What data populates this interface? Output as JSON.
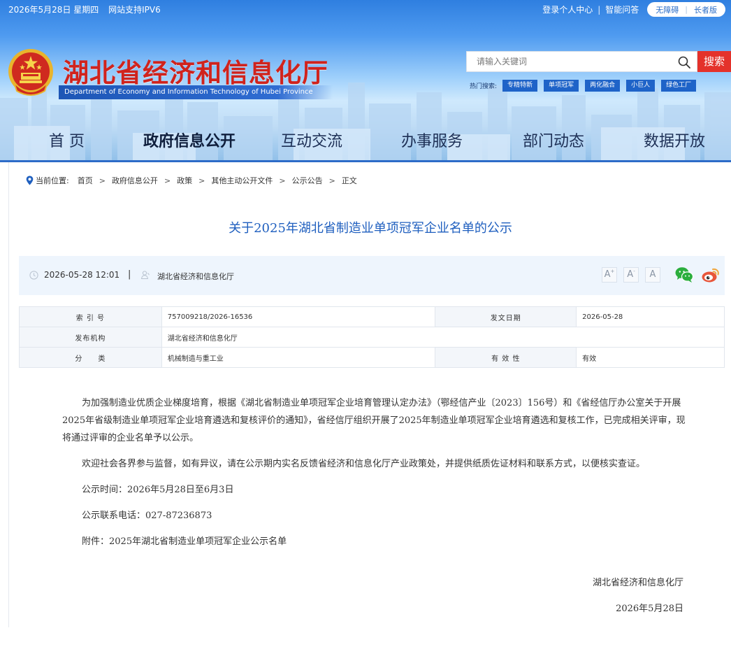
{
  "topbar": {
    "date": "2026年5月28日 星期四",
    "ipv6": "网站支持IPV6",
    "login": "登录个人中心",
    "qa": "智能问答",
    "accessible": "无障碍",
    "elderly": "长者版"
  },
  "site": {
    "title": "湖北省经济和信息化厅",
    "subtitle": "Department of Economy and Information Technology of Hubei Province"
  },
  "search": {
    "placeholder": "请输入关键词",
    "button": "搜索",
    "hot_label": "热门搜索:",
    "hot_tags": [
      "专精特新",
      "单项冠军",
      "两化融合",
      "小巨人",
      "绿色工厂"
    ]
  },
  "nav": {
    "items": [
      "首 页",
      "政府信息公开",
      "互动交流",
      "办事服务",
      "部门动态",
      "数据开放"
    ],
    "active_index": 1
  },
  "breadcrumb": {
    "label": "当前位置:",
    "items": [
      "首页",
      "政府信息公开",
      "政策",
      "其他主动公开文件",
      "公示公告",
      "正文"
    ],
    "separator": ">"
  },
  "article": {
    "title": "关于2025年湖北省制造业单项冠军企业名单的公示",
    "meta_time": "2026-05-28 12:01",
    "meta_divider": "|",
    "meta_org": "湖北省经济和信息化厅",
    "font_buttons": [
      "A",
      "A",
      "A"
    ]
  },
  "info_table": {
    "index_label": "索 引 号",
    "index_value": "757009218/2026-16536",
    "date_label": "发文日期",
    "date_value": "2026-05-28",
    "org_label": "发布机构",
    "org_value": "湖北省经济和信息化厅",
    "cat_label": "分　　类",
    "cat_value": "机械制造与重工业",
    "valid_label": "有 效 性",
    "valid_value": "有效"
  },
  "body": {
    "p1": "为加强制造业优质企业梯度培育，根据《湖北省制造业单项冠军企业培育管理认定办法》（鄂经信产业〔2023〕156号）和《省经信厅办公室关于开展2025年省级制造业单项冠军企业培育遴选和复核评价的通知》，省经信厅组织开展了2025年制造业单项冠军企业培育遴选和复核工作，已完成相关评审，现将通过评审的企业名单予以公示。",
    "p2": "欢迎社会各界参与监督，如有异议，请在公示期内实名反馈省经济和信息化厅产业政策处，并提供纸质佐证材料和联系方式，以便核实查证。",
    "p3": "公示时间：2026年5月28日至6月3日",
    "p4": "公示联系电话：027-87236873",
    "p5": "附件：2025年湖北省制造业单项冠军企业公示名单",
    "sign_org": "湖北省经济和信息化厅",
    "sign_date": "2026年5月28日"
  },
  "colors": {
    "brand_red": "#d0231d",
    "link_blue": "#1f5fbf",
    "nav_line": "#2d6cc8",
    "search_red": "#e4322b"
  }
}
